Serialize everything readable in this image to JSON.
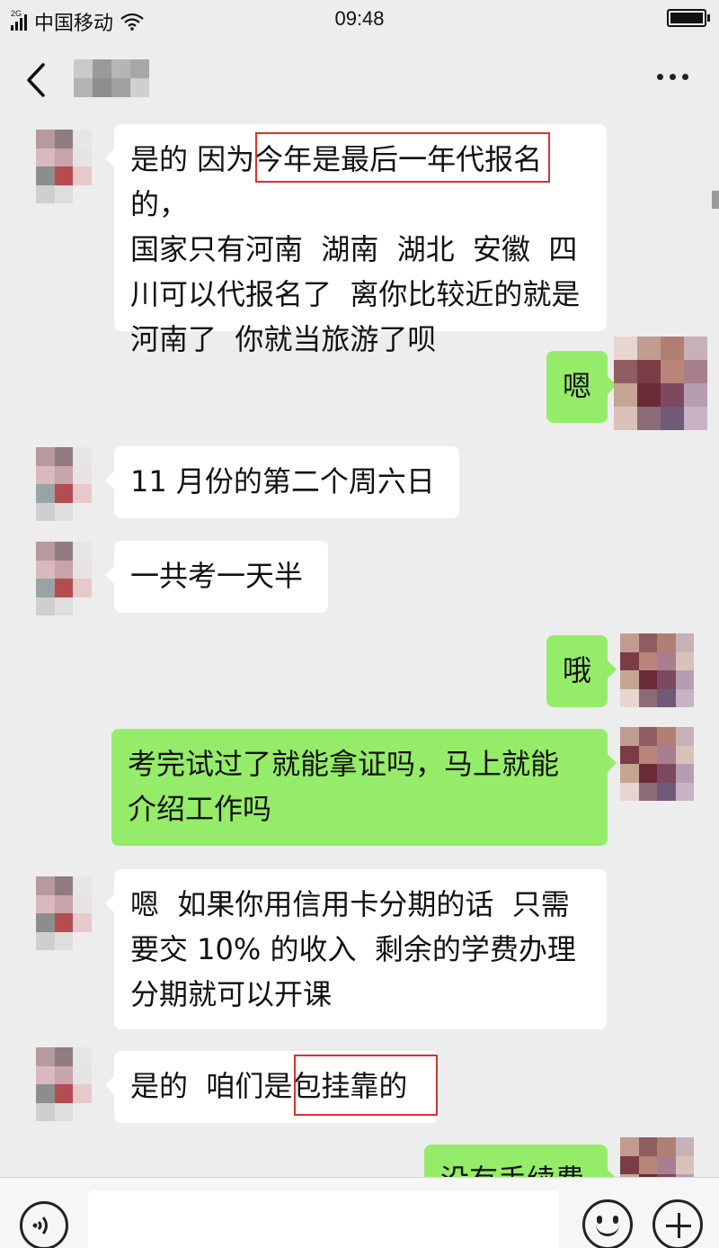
{
  "status_bar": {
    "network": "2G",
    "carrier": "中国移动",
    "time": "09:48"
  },
  "nav": {
    "contact_name": ""
  },
  "messages": [
    {
      "side": "in",
      "text": "是的 因为今年是最后一年代报名的，\n国家只有河南  湖南  湖北  安徽  四\n川可以代报名了  离你比较近的就是\n河南了  你就当旅游了呗"
    },
    {
      "side": "out",
      "text": "嗯"
    },
    {
      "side": "in",
      "text": "11 月份的第二个周六日"
    },
    {
      "side": "in",
      "text": "一共考一天半"
    },
    {
      "side": "out",
      "text": "哦"
    },
    {
      "side": "out",
      "text": "考完试过了就能拿证吗，马上就能\n介绍工作吗"
    },
    {
      "side": "in",
      "text": "嗯  如果你用信用卡分期的话  只需\n要交 10% 的收入  剩余的学费办理\n分期就可以开课"
    },
    {
      "side": "in",
      "text": "是的  咱们是包挂靠的"
    },
    {
      "side": "out",
      "text": "没有手续费"
    }
  ],
  "input": {
    "placeholder": ""
  },
  "colors": {
    "background": "#ededed",
    "incoming_bubble": "#ffffff",
    "outgoing_bubble": "#95ec69",
    "highlight_box": "#d9312c"
  }
}
